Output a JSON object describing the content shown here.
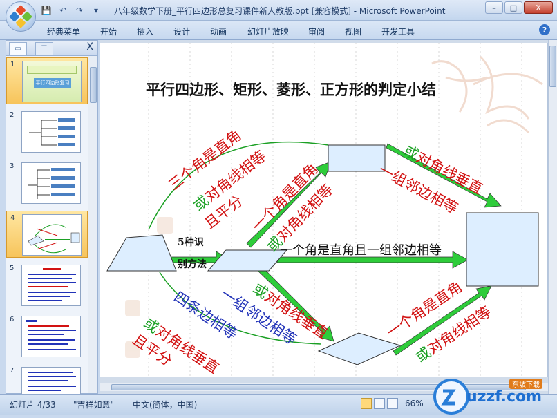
{
  "window": {
    "title": "八年级数学下册_平行四边形总复习课件新人教版.ppt [兼容模式] - Microsoft PowerPoint",
    "minimize": "–",
    "maximize": "□",
    "close": "X"
  },
  "qat": {
    "save": "💾",
    "undo": "↶",
    "redo": "↷",
    "more": "▾"
  },
  "ribbon": {
    "tabs": [
      "经典菜单",
      "开始",
      "插入",
      "设计",
      "动画",
      "幻灯片放映",
      "审阅",
      "视图",
      "开发工具"
    ],
    "help": "?"
  },
  "slide_pane": {
    "close": "X",
    "slides": [
      {
        "num": "1"
      },
      {
        "num": "2"
      },
      {
        "num": "3"
      },
      {
        "num": "4",
        "active": true
      },
      {
        "num": "5"
      },
      {
        "num": "6"
      },
      {
        "num": "7"
      }
    ],
    "slide1_title": "平行四边形复习"
  },
  "slide": {
    "title": "平行四边形、矩形、菱形、正方形的判定小结",
    "center_label_1": "5种识",
    "center_label_2": "别方法",
    "top_left_1": "三个角是直角",
    "top_left_2_prefix": "或",
    "top_left_2": "对角线相等",
    "top_left_3": "且平分",
    "mid_up_1": "一个角是直角",
    "mid_up_2_prefix": "或",
    "mid_up_2": "对角线相等",
    "top_right_1_prefix": "或",
    "top_right_1": "对角线垂直",
    "top_right_2": "一组邻边相等",
    "middle_text": "一个角是直角且一组邻边相等",
    "mid_down_1": "一组邻边相等",
    "mid_down_2_prefix": "或",
    "mid_down_2": "对角线垂直",
    "bottom_left_1": "四条边相等",
    "bottom_left_2_prefix": "或",
    "bottom_left_2": "对角线垂直",
    "bottom_left_3": "且平分",
    "bottom_right_1": "一个角是直角",
    "bottom_right_2_prefix": "或",
    "bottom_right_2": "对角线相等"
  },
  "status": {
    "slide": "幻灯片 4/33",
    "theme": "\"吉祥如意\"",
    "language": "中文(简体，中国)",
    "zoom": "66%"
  },
  "watermark": {
    "brand": "uzzf.com",
    "sub": "东坡下载"
  },
  "colors": {
    "red": "#d21212",
    "green": "#1ba024",
    "blue": "#2233b8",
    "shape_fill": "#ddeeff"
  }
}
